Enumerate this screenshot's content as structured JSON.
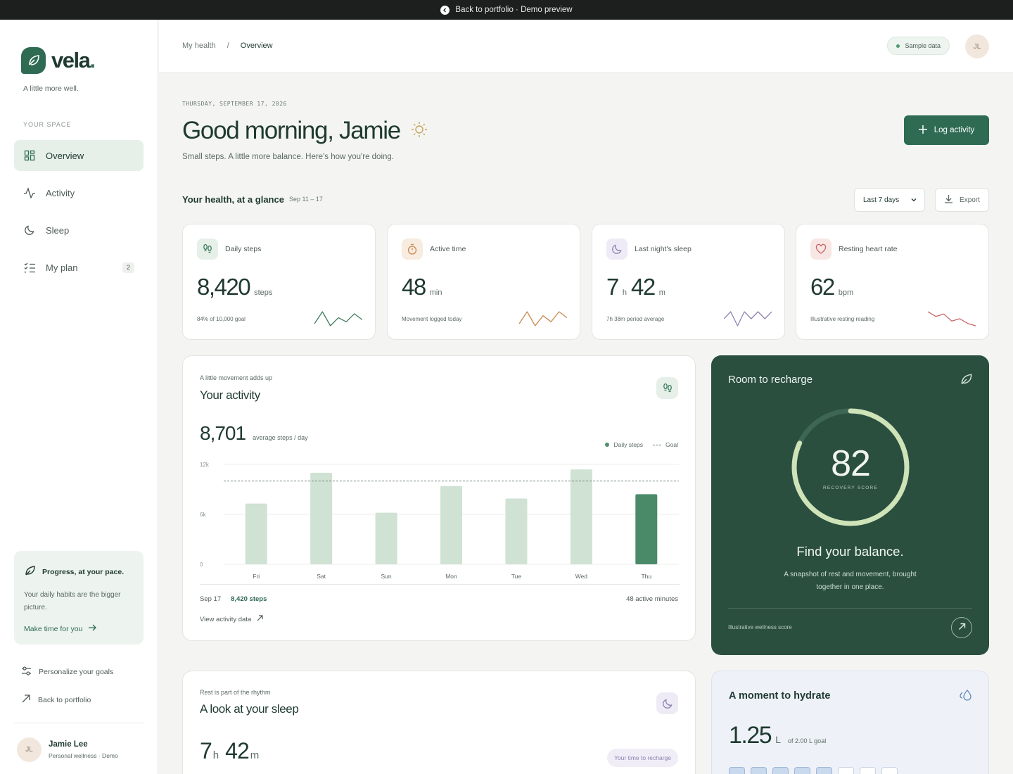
{
  "topbar": {
    "text": "Back to portfolio · Demo preview"
  },
  "brand": {
    "name": "vela",
    "dot": ".",
    "tagline": "A little more well."
  },
  "sidebar": {
    "section_label": "YOUR SPACE",
    "items": [
      {
        "label": "Overview",
        "icon": "grid-icon",
        "active": true
      },
      {
        "label": "Activity",
        "icon": "pulse-icon"
      },
      {
        "label": "Sleep",
        "icon": "moon-icon"
      },
      {
        "label": "My plan",
        "icon": "checklist-icon",
        "badge": "2"
      }
    ],
    "promo": {
      "title": "Progress, at your pace.",
      "text": "Your daily habits are the bigger picture.",
      "link": "Make time for you"
    },
    "links": [
      {
        "label": "Personalize your goals",
        "icon": "sliders-icon"
      },
      {
        "label": "Back to portfolio",
        "icon": "arrow-up-right-icon"
      }
    ],
    "user": {
      "initials": "JL",
      "name": "Jamie Lee",
      "subtitle": "Personal wellness · Demo"
    }
  },
  "header": {
    "breadcrumb": [
      "My health",
      "/",
      "Overview"
    ],
    "sample_pill": "Sample data",
    "avatar_initials": "JL"
  },
  "hero": {
    "date": "THURSDAY, SEPTEMBER 17, 2026",
    "greeting": "Good morning, Jamie",
    "subtitle": "Small steps. A little more balance. Here's how you're doing.",
    "log_button": "Log activity"
  },
  "glance": {
    "title": "Your health, at a glance",
    "range": "Sep 11 – 17",
    "period_select": "Last 7 days",
    "export_label": "Export"
  },
  "metrics": [
    {
      "label": "Daily steps",
      "value": "8,420",
      "unit": "steps",
      "note": "84% of 10,000 goal",
      "icon": "footprints-icon",
      "color": "#3f7d5e",
      "bg": "#e6f0e9",
      "spark": [
        4,
        10,
        3,
        7,
        5,
        9,
        6
      ]
    },
    {
      "label": "Active time",
      "value": "48",
      "unit": "min",
      "note": "Movement logged today",
      "icon": "stopwatch-icon",
      "color": "#c98b52",
      "bg": "#f8ebdf",
      "spark": [
        5,
        11,
        4,
        9,
        6,
        11,
        8
      ]
    },
    {
      "label": "Last night's sleep",
      "value_h": "7",
      "h": "h",
      "value_m": "42",
      "m": "m",
      "note": "7h 38m period average",
      "icon": "moon-icon",
      "color": "#8e82b0",
      "bg": "#eeebf6",
      "spark": [
        6,
        7,
        5,
        7,
        6,
        7,
        6,
        7
      ]
    },
    {
      "label": "Resting heart rate",
      "value": "62",
      "unit": "bpm",
      "note": "Illustrative resting reading",
      "icon": "heart-icon",
      "color": "#c96363",
      "bg": "#f8e6e4",
      "spark": [
        9,
        7,
        8,
        5,
        6,
        4,
        3
      ]
    }
  ],
  "activity": {
    "eyebrow": "A little movement adds up",
    "title": "Your activity",
    "average": "8,701",
    "average_unit": "average steps / day",
    "legend_daily": "Daily steps",
    "legend_goal": "Goal",
    "footer_date": "Sep 17",
    "footer_steps": "8,420 steps",
    "footer_minutes": "48 active minutes",
    "link": "View activity data"
  },
  "chart_data": {
    "type": "bar",
    "categories": [
      "Fri",
      "Sat",
      "Sun",
      "Mon",
      "Tue",
      "Wed",
      "Thu"
    ],
    "series": [
      {
        "name": "Daily steps",
        "values": [
          7300,
          11000,
          6200,
          9400,
          7900,
          11400,
          8420
        ]
      }
    ],
    "goal": 10000,
    "yticks": [
      "0",
      "6k",
      "12k"
    ],
    "ylim": [
      0,
      12000
    ],
    "highlight_index": 6,
    "colors": {
      "bar": "#cfe2d4",
      "highlight": "#4a8a69",
      "goal": "#7a8a82"
    }
  },
  "recovery": {
    "title": "Room to recharge",
    "score": "82",
    "score_label": "RECOVERY SCORE",
    "score_fraction": 0.82,
    "heading": "Find your balance.",
    "text": "A snapshot of rest and movement, brought together in one place.",
    "note": "Illustrative wellness score"
  },
  "sleep": {
    "eyebrow": "Rest is part of the rhythm",
    "title": "A look at your sleep",
    "hours": "7",
    "h": "h",
    "minutes": "42",
    "m": "m",
    "tag": "Your time to recharge"
  },
  "hydration": {
    "title": "A moment to hydrate",
    "value": "1.25",
    "unit": "L",
    "goal": "of 2.00 L goal",
    "cups_total": 8,
    "cups_filled": 5
  }
}
